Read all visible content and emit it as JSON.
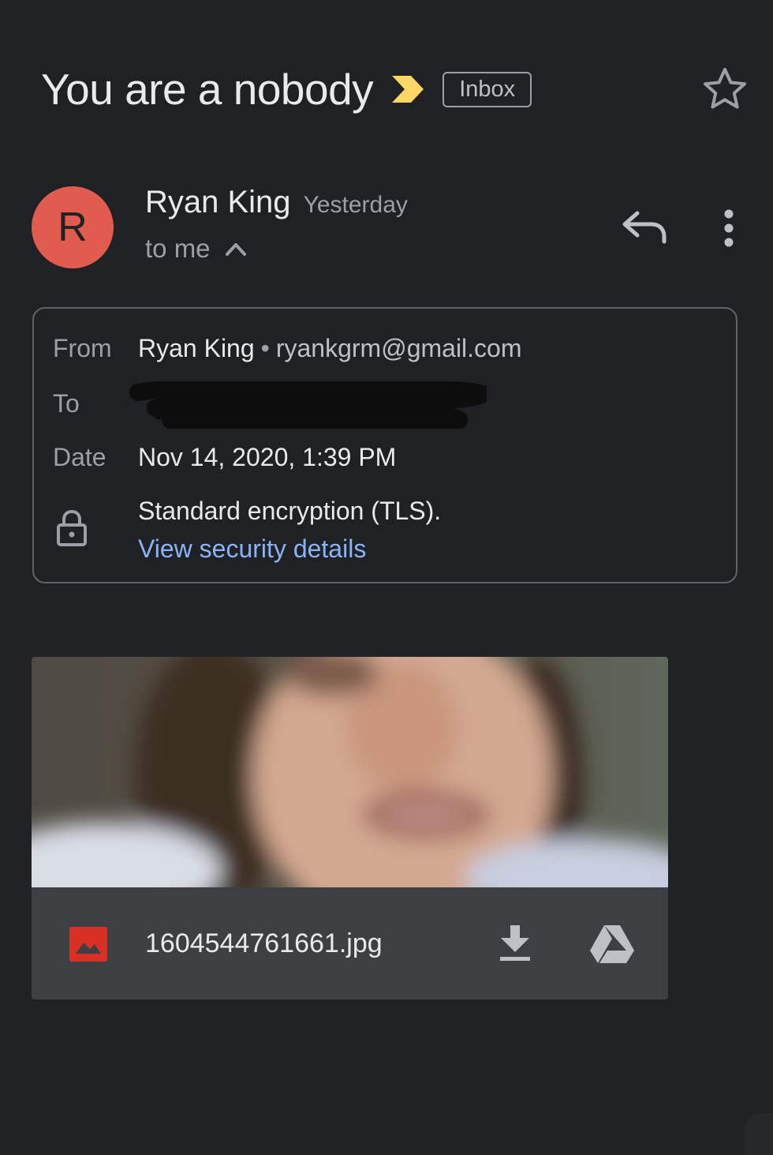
{
  "colors": {
    "background": "#202124",
    "avatar": "#e25b4f",
    "link": "#8ab4f8",
    "importance_marker": "#fdd663",
    "image_file_icon": "#d93025",
    "attachment_bar": "#3c4043"
  },
  "header": {
    "subject": "You are a nobody",
    "label": "Inbox",
    "importance_icon": "importance-marker-icon",
    "star_icon": "star-outline-icon"
  },
  "sender": {
    "avatar_letter": "R",
    "name": "Ryan King",
    "time": "Yesterday",
    "recipient_summary": "to me",
    "reply_icon": "reply-icon",
    "more_icon": "more-vert-icon"
  },
  "details": {
    "from_label": "From",
    "from_name": "Ryan King",
    "from_separator": "•",
    "from_email": "ryankgrm@gmail.com",
    "to_label": "To",
    "date_label": "Date",
    "date_value": "Nov 14, 2020, 1:39 PM",
    "encryption_text": "Standard encryption (TLS).",
    "security_link": "View security details",
    "lock_icon": "lock-icon"
  },
  "attachment": {
    "filename": "1604544761661.jpg",
    "type_icon": "image-file-icon",
    "download_icon": "download-icon",
    "drive_icon": "google-drive-icon"
  }
}
